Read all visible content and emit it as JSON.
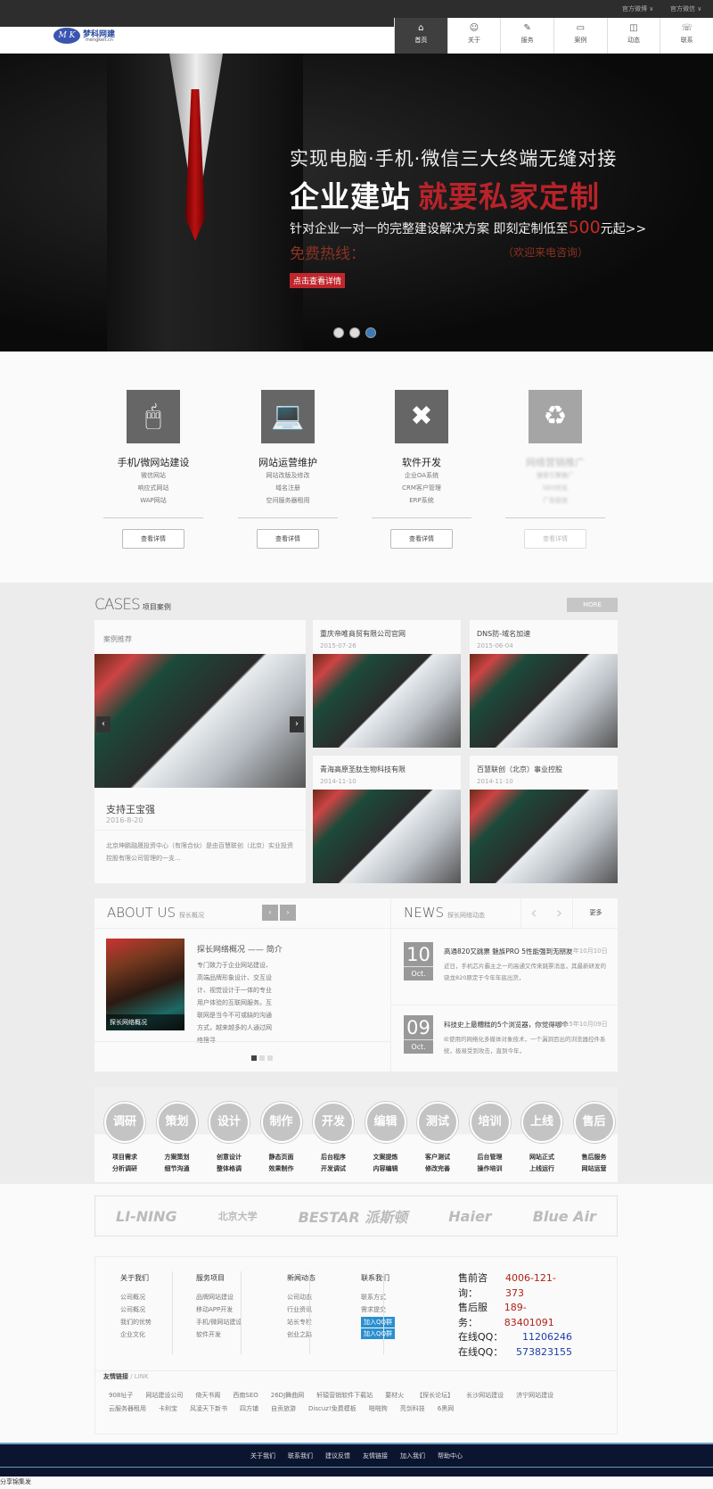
{
  "topbar": {
    "weibo": "官方微博 ∨",
    "weixin": "官方微信 ∨"
  },
  "logo": {
    "mark": "M K",
    "cn": "梦科网建",
    "en": "mengkeit.cn"
  },
  "nav": [
    {
      "label": "首页",
      "icon": "⌂"
    },
    {
      "label": "关于",
      "icon": "☺"
    },
    {
      "label": "服务",
      "icon": "✎"
    },
    {
      "label": "案例",
      "icon": "▭"
    },
    {
      "label": "动态",
      "icon": "◫"
    },
    {
      "label": "联系",
      "icon": "☏"
    }
  ],
  "banner": {
    "line1": "实现电脑·手机·微信三大终端无缝对接",
    "line2a": "企业建站",
    "line2b": "就要私家定制",
    "line3": "针对企业一对一的完整建设解决方案   即刻定制低至",
    "price": "500",
    "line3b": "元起>>",
    "hotline": "免费热线：",
    "consult": "（欢迎来电咨询）",
    "cta": "点击查看详情"
  },
  "services": [
    {
      "title": "手机/微网站建设",
      "items": [
        "微信网站",
        "响应式网站",
        "WAP网站"
      ],
      "btn": "查看详情",
      "icon": "mouse-icon",
      "glyph": "🖱"
    },
    {
      "title": "网站运营维护",
      "items": [
        "网站改版及修改",
        "域名注册",
        "空间服务器租用"
      ],
      "btn": "查看详情",
      "icon": "laptop-icon",
      "glyph": "💻"
    },
    {
      "title": "软件开发",
      "items": [
        "企业OA系统",
        "CRM客户管理",
        "ERP系统"
      ],
      "btn": "查看详情",
      "icon": "joomla-icon",
      "glyph": "✖"
    },
    {
      "title": "网络营销推广",
      "items": [
        "搜索引擎推广",
        "SEO优化",
        "广告投放"
      ],
      "btn": "查看详情",
      "icon": "recycle-icon",
      "glyph": "♻"
    }
  ],
  "cases": {
    "title": "CASES",
    "subtitle": "项目案例",
    "more": "MORE",
    "featured_label": "案例推荐",
    "featured": {
      "title": "支持王宝强",
      "date": "2016-8-20",
      "desc": "北京坤鹏融晟投资中心（有限合伙）是由百慧联创（北京）实业投资控股有限公司管理的一支..."
    },
    "items": [
      {
        "title": "重庆帝唯商贸有限公司官网",
        "date": "2015-07-26"
      },
      {
        "title": "DNS防-域名加速",
        "date": "2015-06-04"
      },
      {
        "title": "青海高原圣肽生物科技有限",
        "date": "2014-11-10"
      },
      {
        "title": "百慧联创（北京）事业控股",
        "date": "2014-11-10"
      }
    ]
  },
  "about": {
    "title": "ABOUT US",
    "subtitle": "探长概况",
    "caption": "探长网络概况",
    "heading": "探长网络概况 —— 简介",
    "text": "专门致力于企业网站建设、高端品牌形象设计、交互设计、视觉设计于一体的专业用户体验的互联网服务。互联网是当今不可或缺的沟通方式，越来越多的人通过网络搜寻..."
  },
  "news": {
    "title": "NEWS",
    "subtitle": "探长网络动态",
    "more": "更多",
    "items": [
      {
        "day": "10",
        "month": "Oct.",
        "title": "高通820又跳票 魅族PRO 5性能强到无朋友",
        "date": "2015年10月10日",
        "desc": "近日，手机芯片霸主之一的高通又传来跳票消息，其最新研发的骁龙820原定于今年年底出货，"
      },
      {
        "day": "09",
        "month": "Oct.",
        "title": "科技史上最糟糕的5个浏览器，你觉得哪个",
        "date": "2015年10月09日",
        "desc": "IE使用的网络化多媒体对象技术，一个漏洞百出的浏览器控件系统，极易受到攻击，直到今年，"
      }
    ]
  },
  "process": [
    {
      "n": "调研",
      "a": "项目需求",
      "b": "分析调研"
    },
    {
      "n": "策划",
      "a": "方案策划",
      "b": "细节沟通"
    },
    {
      "n": "设计",
      "a": "创意设计",
      "b": "整体格调"
    },
    {
      "n": "制作",
      "a": "静态页面",
      "b": "效果制作"
    },
    {
      "n": "开发",
      "a": "后台程序",
      "b": "开发调试"
    },
    {
      "n": "编辑",
      "a": "文案提炼",
      "b": "内容编辑"
    },
    {
      "n": "测试",
      "a": "客户测试",
      "b": "修改完善"
    },
    {
      "n": "培训",
      "a": "后台管理",
      "b": "操作培训"
    },
    {
      "n": "上线",
      "a": "网站正式",
      "b": "上线运行"
    },
    {
      "n": "售后",
      "a": "售后服务",
      "b": "网站运营"
    }
  ],
  "partners": [
    "LI-NING",
    "北京大学",
    "BESTAR 派斯顿",
    "Haier",
    "Blue Air"
  ],
  "footer": {
    "cols": [
      {
        "title": "关于我们",
        "items": [
          "公司概况",
          "公司概况",
          "我们的优势",
          "企业文化"
        ]
      },
      {
        "title": "服务项目",
        "items": [
          "品牌网站建设",
          "移动APP开发",
          "手机/微网站建设",
          "软件开发"
        ]
      },
      {
        "title": "新闻动态",
        "items": [
          "公司动态",
          "行业资讯",
          "站长专栏",
          "创业之路"
        ]
      },
      {
        "title": "联系我们",
        "items": [
          "联系方式",
          "需求提交"
        ],
        "qq": [
          "加入QQ群",
          "加入QQ群"
        ]
      }
    ],
    "contact": [
      {
        "label": "售前咨询：",
        "value": "4006-121-373"
      },
      {
        "label": "售后服务：",
        "value": "189-83401091"
      },
      {
        "label": "在线QQ：",
        "value": "11206246"
      },
      {
        "label": "在线QQ：",
        "value": "573823155"
      }
    ],
    "links_title": "友情链接",
    "links_en": " / LINK",
    "links": [
      "908址子",
      "网站建设公司",
      "倚天书阁",
      "西南SEO",
      "26DJ舞曲网",
      "轩辕营销软件下载站",
      "要材火",
      "【探长论坛】",
      "长沙网站建设",
      "济宁网站建设",
      "云服务器租用",
      "卡利宝",
      "风凌天下新书",
      "四方铺",
      "自贡旅游",
      "Discuz!免费模板",
      "啪啪狗",
      "亮剑科技",
      "6黑网"
    ],
    "bottom_nav": [
      "关于我们",
      "联系我们",
      "建议反馈",
      "友情链接",
      "加入我们",
      "帮助中心"
    ]
  },
  "status": "分享锦集发"
}
